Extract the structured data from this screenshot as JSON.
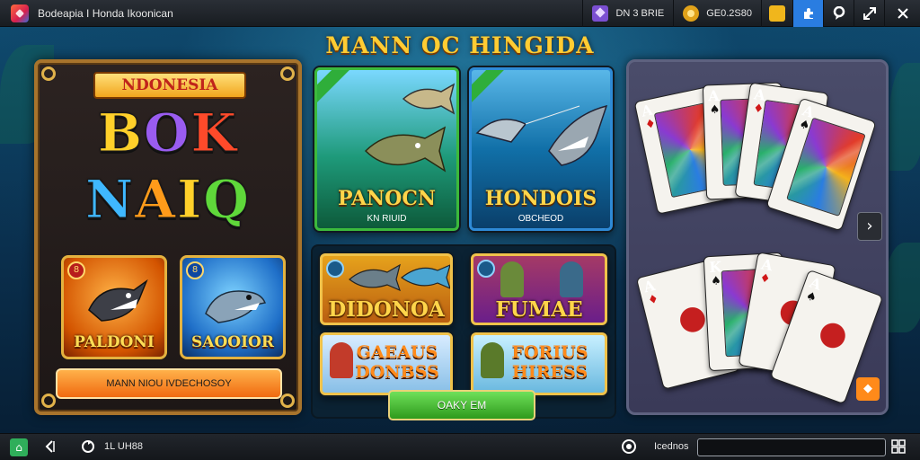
{
  "window": {
    "title": "Bodeapia I Honda Ikoonican"
  },
  "topbar": {
    "gems_value": "DN 3 BRIE",
    "coins_value": "GE0.2S80",
    "buttons": [
      "add-friend",
      "profile",
      "expand",
      "close"
    ]
  },
  "hero_title": "MANN OC HINGIDA",
  "left_panel": {
    "banner": "NDONESIA",
    "logo_line1": [
      "B",
      "O",
      "K"
    ],
    "logo_line2": [
      "N",
      "A",
      "I",
      "Q"
    ],
    "tiles": [
      {
        "badge": "8",
        "label": "PALDONI"
      },
      {
        "badge": "8",
        "label": "SAOOIOR"
      }
    ],
    "cta_button": "MANN NIOU IVDECHOSOY"
  },
  "game_tiles": [
    {
      "title": "PANOCN",
      "subtitle": "KN RIUID"
    },
    {
      "title": "HONDOIS",
      "subtitle": "OBCHEOD"
    },
    {
      "title": "DIDONOA"
    },
    {
      "title": "FUMAE"
    },
    {
      "title_line1": "GAEAUS",
      "title_line2": "DONBSS"
    },
    {
      "title_line1": "FORIUS",
      "title_line2": "HIRESS"
    }
  ],
  "play_button": "OAKY EM",
  "cards_panel": {
    "top_row": [
      {
        "rank": "A",
        "suit": "♦",
        "color": "#d01818"
      },
      {
        "rank": "A",
        "suit": "♠",
        "color": "#111111"
      },
      {
        "rank": "A",
        "suit": "♦",
        "color": "#d01818"
      },
      {
        "rank": "A",
        "suit": "♠",
        "color": "#111111"
      }
    ],
    "bottom_row": [
      {
        "rank": "A",
        "suit": "♦",
        "color": "#d01818"
      },
      {
        "rank": "K",
        "suit": "♠",
        "color": "#111111"
      },
      {
        "rank": "A",
        "suit": "♦",
        "color": "#d01818"
      },
      {
        "rank": "A",
        "suit": "♠",
        "color": "#111111"
      }
    ],
    "next_arrow": "›",
    "corner_badge": "◆"
  },
  "bottombar": {
    "status_text": "1L UH88",
    "search_label": "Icednos",
    "search_value": ""
  },
  "colors": {
    "accent_gold": "#ffcc33",
    "topbar_active": "#2a7de1",
    "cta_orange": "#f06a10",
    "play_green": "#2e9a1c"
  }
}
